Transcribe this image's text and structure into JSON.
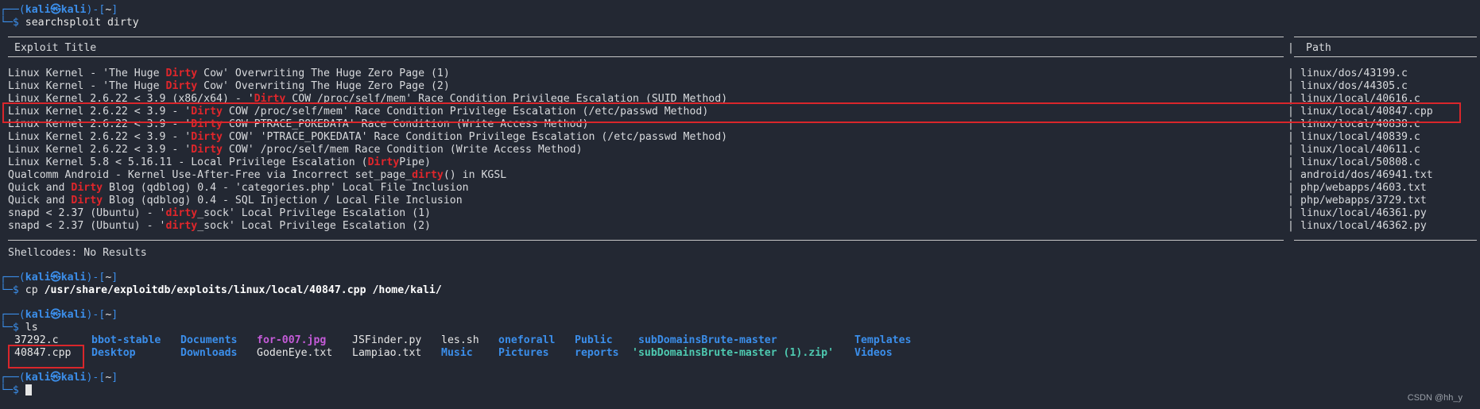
{
  "prompt": {
    "user": "kali",
    "at": "㉿",
    "host": "kali",
    "dir": "~"
  },
  "cmd1": "searchsploit dirty",
  "table": {
    "head_title": "Exploit Title",
    "head_path": "Path",
    "rows": [
      {
        "pre": "Linux Kernel - 'The Huge ",
        "hl": "Dirty",
        "post": " Cow' Overwriting The Huge Zero Page (1)",
        "path": "linux/dos/43199.c"
      },
      {
        "pre": "Linux Kernel - 'The Huge ",
        "hl": "Dirty",
        "post": " Cow' Overwriting The Huge Zero Page (2)",
        "path": "linux/dos/44305.c"
      },
      {
        "pre": "Linux Kernel 2.6.22 < 3.9 (x86/x64) - '",
        "hl": "Dirty",
        "post": " COW /proc/self/mem' Race Condition Privilege Escalation (SUID Method)",
        "path": "linux/local/40616.c"
      },
      {
        "pre": "Linux Kernel 2.6.22 < 3.9 - '",
        "hl": "Dirty",
        "post": " COW /proc/self/mem' Race Condition Privilege Escalation (/etc/passwd Method)",
        "path": "linux/local/40847.cpp"
      },
      {
        "pre": "Linux Kernel 2.6.22 < 3.9 - '",
        "hl": "Dirty",
        "post": " COW PTRACE_POKEDATA' Race Condition (Write Access Method)",
        "path": "linux/local/40838.c"
      },
      {
        "pre": "Linux Kernel 2.6.22 < 3.9 - '",
        "hl": "Dirty",
        "post": " COW' 'PTRACE_POKEDATA' Race Condition Privilege Escalation (/etc/passwd Method)",
        "path": "linux/local/40839.c"
      },
      {
        "pre": "Linux Kernel 2.6.22 < 3.9 - '",
        "hl": "Dirty",
        "post": " COW' /proc/self/mem Race Condition (Write Access Method)",
        "path": "linux/local/40611.c"
      },
      {
        "pre": "Linux Kernel 5.8 < 5.16.11 - Local Privilege Escalation (",
        "hl": "Dirty",
        "post": "Pipe)",
        "path": "linux/local/50808.c"
      },
      {
        "pre": "Qualcomm Android - Kernel Use-After-Free via Incorrect set_page_",
        "hl": "dirty",
        "post": "() in KGSL",
        "path": "android/dos/46941.txt"
      },
      {
        "pre": "Quick and ",
        "hl": "Dirty",
        "post": " Blog (qdblog) 0.4 - 'categories.php' Local File Inclusion",
        "path": "php/webapps/4603.txt"
      },
      {
        "pre": "Quick and ",
        "hl": "Dirty",
        "post": " Blog (qdblog) 0.4 - SQL Injection / Local File Inclusion",
        "path": "php/webapps/3729.txt"
      },
      {
        "pre": "snapd < 2.37 (Ubuntu) - '",
        "hl": "dirty",
        "post": "_sock' Local Privilege Escalation (1)",
        "path": "linux/local/46361.py"
      },
      {
        "pre": "snapd < 2.37 (Ubuntu) - '",
        "hl": "dirty",
        "post": "_sock' Local Privilege Escalation (2)",
        "path": "linux/local/46362.py"
      }
    ]
  },
  "shellcodes": "Shellcodes: No Results",
  "cmd2_verb": "cp",
  "cmd2_args": "/usr/share/exploitdb/exploits/linux/local/40847.cpp /home/kali/",
  "cmd3": "ls",
  "ls_row1": [
    "37292.c",
    "bbot-stable",
    "Documents",
    "for-007.jpg",
    "JSFinder.py",
    "les.sh",
    "oneforall",
    "Public",
    "subDomainsBrute-master",
    "Templates"
  ],
  "ls_row2": [
    "40847.cpp",
    "Desktop",
    "Downloads",
    "GodenEye.txt",
    "Lampiao.txt",
    "Music",
    "Pictures",
    "reports",
    "'subDomainsBrute-master (1).zip'",
    "Videos"
  ],
  "watermark": "CSDN @hh_y",
  "colors": {
    "bg": "#232833",
    "prompt": "#3b8eea",
    "highlight": "#e0262b",
    "box": "#d9262b"
  }
}
